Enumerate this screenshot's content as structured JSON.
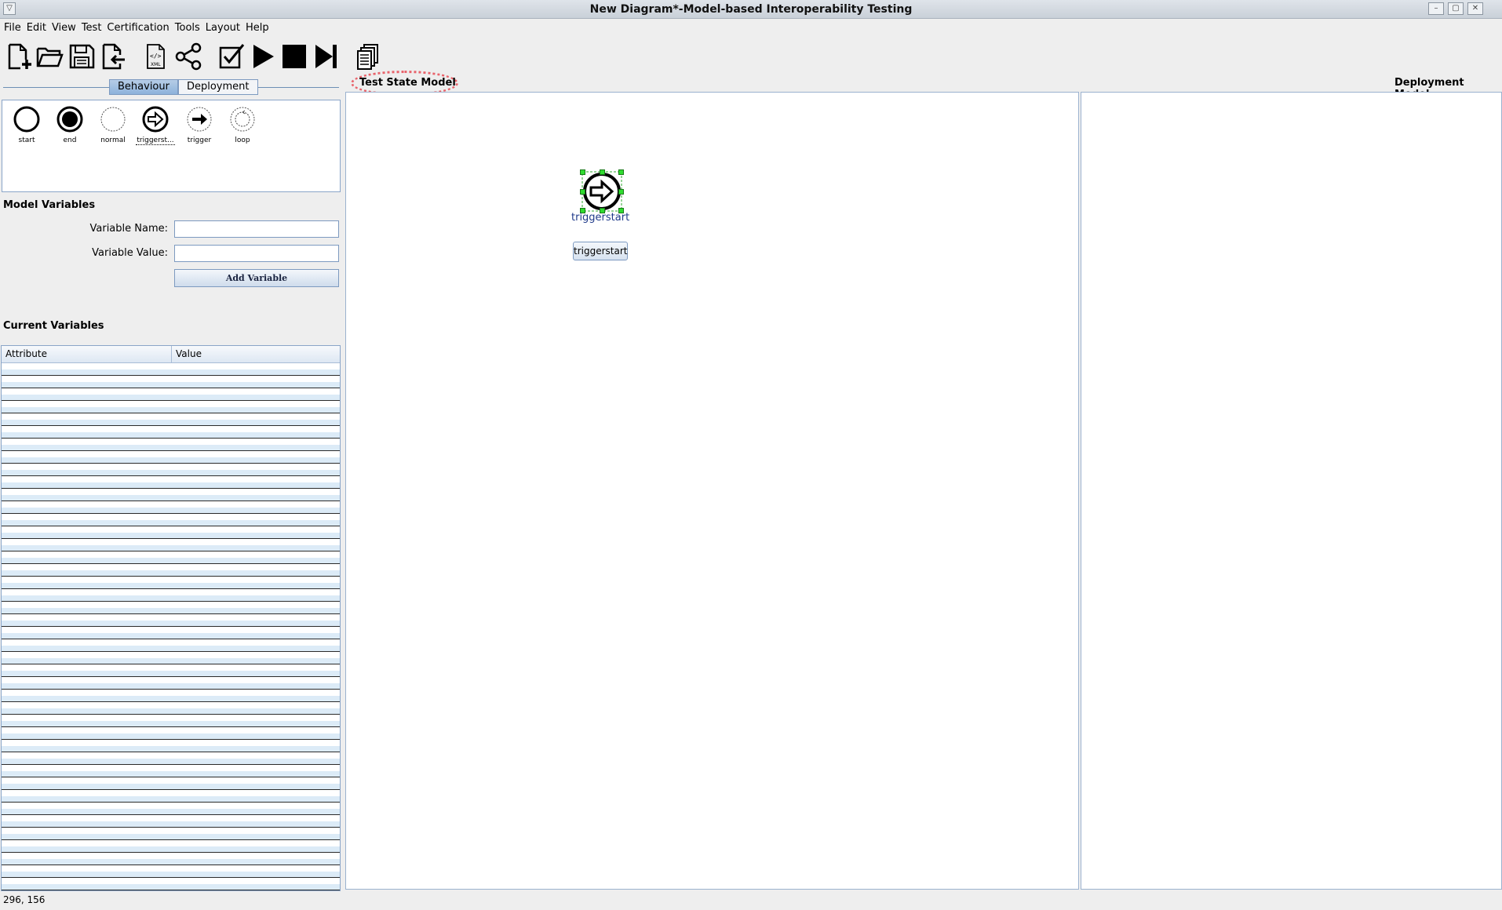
{
  "window": {
    "title": "New Diagram*-Model-based Interoperability Testing"
  },
  "menu": [
    "File",
    "Edit",
    "View",
    "Test",
    "Certification",
    "Tools",
    "Layout",
    "Help"
  ],
  "toolbar_icons": [
    "new-file-icon",
    "open-folder-icon",
    "save-icon",
    "import-icon",
    "xml-export-icon",
    "share-graph-icon",
    "validate-check-icon",
    "play-icon",
    "stop-icon",
    "step-forward-icon",
    "report-documents-icon"
  ],
  "tabs": {
    "behaviour": "Behaviour",
    "deployment": "Deployment",
    "active": "Behaviour"
  },
  "palette": {
    "items": [
      {
        "label": "start",
        "icon": "start-node-icon"
      },
      {
        "label": "end",
        "icon": "end-node-icon"
      },
      {
        "label": "normal",
        "icon": "normal-node-icon"
      },
      {
        "label": "triggerst...",
        "icon": "triggerstart-node-icon"
      },
      {
        "label": "trigger",
        "icon": "trigger-node-icon"
      },
      {
        "label": "loop",
        "icon": "loop-node-icon"
      }
    ]
  },
  "model_variables": {
    "heading": "Model Variables",
    "name_label": "Variable Name:",
    "name_value": "",
    "value_label": "Variable Value:",
    "value_value": "",
    "add_button": "Add Variable"
  },
  "current_variables": {
    "heading": "Current Variables",
    "columns": [
      "Attribute",
      "Value"
    ],
    "rows": []
  },
  "test_state_model": {
    "title": "Test State Model",
    "node": {
      "label": "triggerstart",
      "button": "triggerstart",
      "icon": "triggerstart-node-icon"
    }
  },
  "deployment_model": {
    "title": "Deployment Model"
  },
  "status": {
    "coords": "296, 156"
  }
}
